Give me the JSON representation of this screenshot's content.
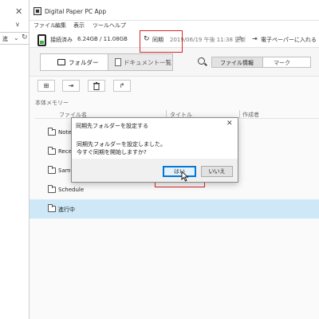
{
  "left_panel": {
    "close_glyph": "✕",
    "chevron_glyph": "∨",
    "address_value": "進",
    "refresh_glyph": "↻"
  },
  "app": {
    "title": "Digital Paper PC App"
  },
  "menu": [
    "ファイル",
    "編集",
    "表示",
    "ツール",
    "ヘルプ"
  ],
  "status": {
    "connection": "接続済み",
    "storage": "6.24GB / 11.08GB",
    "sync_label": "同期",
    "last_sync": "2019/06/19 午後 11:38 更新",
    "export_label": "電子ペーパーに入れる"
  },
  "tabs": {
    "folder": "フォルダー",
    "documents": "ドキュメント一覧"
  },
  "info_tabs": {
    "file_info": "ファイル情報",
    "mark": "マーク"
  },
  "toolbar_buttons": [
    {
      "icon": "new-folder-icon",
      "glyph": "⊞"
    },
    {
      "icon": "import-icon",
      "glyph": "⇥"
    },
    {
      "icon": "delete-icon",
      "glyph": "🗑"
    },
    {
      "icon": "move-folder-icon",
      "glyph": "↱"
    }
  ],
  "section_label": "本体メモリー",
  "columns": {
    "file_name": "ファイル名",
    "title": "タイトル",
    "author": "作成者"
  },
  "files": [
    {
      "name": "Note"
    },
    {
      "name": "Recei"
    },
    {
      "name": "Samp"
    },
    {
      "name": "Schedule"
    },
    {
      "name": "進行中"
    }
  ],
  "dialog": {
    "title": "同期先フォルダーを設定する",
    "message_line1": "同期先フォルダーを設定しました。",
    "message_line2": "今すぐ同期を開始しますか?",
    "yes_label": "はい",
    "no_label": "いいえ",
    "close_glyph": "✕"
  },
  "colors": {
    "highlight": "#d9262a",
    "selected_row": "#cfe8f7",
    "default_button_border": "#0078d7",
    "device_indicator": "#3fb23f"
  }
}
